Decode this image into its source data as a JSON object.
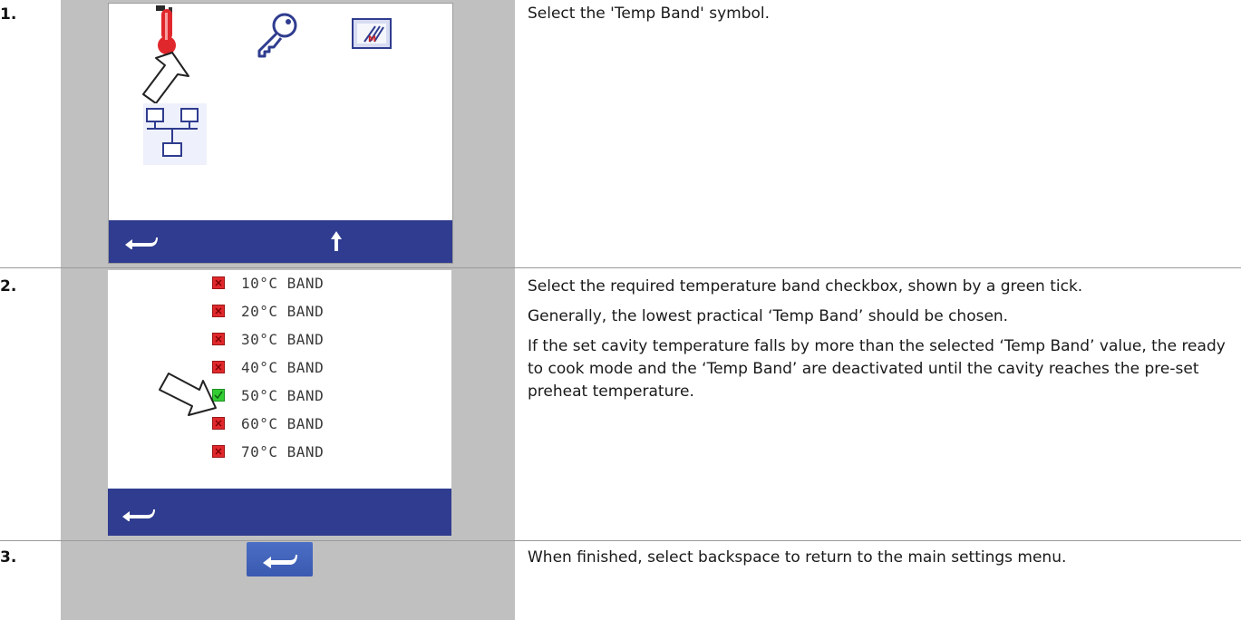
{
  "steps": [
    {
      "number": "1.",
      "paragraphs": [
        "Select the 'Temp Band' symbol."
      ]
    },
    {
      "number": "2.",
      "paragraphs": [
        "Select the required temperature band checkbox, shown by a green tick.",
        "Generally, the lowest practical ‘Temp Band’ should be chosen.",
        "If the set cavity temperature falls by more than the selected ‘Temp Band’ value, the ready to cook mode and the ‘Temp Band’ are deactivated until the cavity reaches the pre-set preheat temperature."
      ]
    },
    {
      "number": "3.",
      "paragraphs": [
        "When finished, select backspace to return to the main settings menu."
      ]
    }
  ],
  "screen1": {
    "icons": [
      "thermometer-icon",
      "key-icon",
      "logo-icon",
      "network-icon"
    ],
    "nav": [
      "back-arrow-icon",
      "up-arrow-icon"
    ]
  },
  "bands": [
    {
      "label": "10°C BAND",
      "checked": false
    },
    {
      "label": "20°C BAND",
      "checked": false
    },
    {
      "label": "30°C BAND",
      "checked": false
    },
    {
      "label": "40°C BAND",
      "checked": false
    },
    {
      "label": "50°C BAND",
      "checked": true
    },
    {
      "label": "60°C BAND",
      "checked": false
    },
    {
      "label": "70°C BAND",
      "checked": false
    }
  ],
  "colors": {
    "navbar": "#2f3c8f",
    "unchecked": "#e0282c",
    "checked": "#33cc33",
    "panel": "#c0c0c0"
  }
}
